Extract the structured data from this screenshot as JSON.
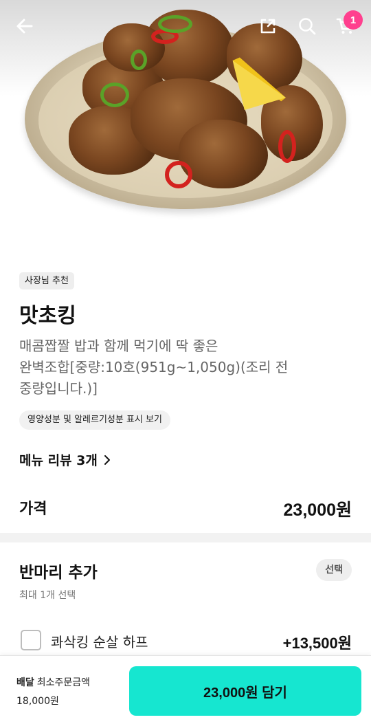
{
  "header": {
    "icons": [
      "back-arrow-icon",
      "share-icon",
      "search-icon",
      "cart-icon"
    ],
    "cart_count": "1",
    "cart_badge_color": "#ff3f8e"
  },
  "product": {
    "tag": "사장님 추천",
    "name": "맛초킹",
    "description_lines": [
      "매콤짭짤 밥과 함께 먹기에 딱 좋은",
      "완벽조합[중량:10호(951g~1,050g)(조리 전",
      "중량입니다.)]"
    ],
    "nutrition_link": "영양성분 및 알레르기성분 표시 보기",
    "review_link": "메뉴 리뷰 3개",
    "price_label": "가격",
    "price_value": "23,000원"
  },
  "option_group": {
    "title": "반마리 추가",
    "badge": "선택",
    "subtitle": "최대 1개 선택",
    "options": [
      {
        "label": "콰삭킹 순살 하프",
        "price": "+13,500원",
        "checked": false
      }
    ]
  },
  "bottom_bar": {
    "delivery_label": "배달",
    "min_order_label": "최소주문금액",
    "min_order_value": "18,000원",
    "add_button_label": "23,000원 담기",
    "accent_color": "#16e6d0"
  }
}
